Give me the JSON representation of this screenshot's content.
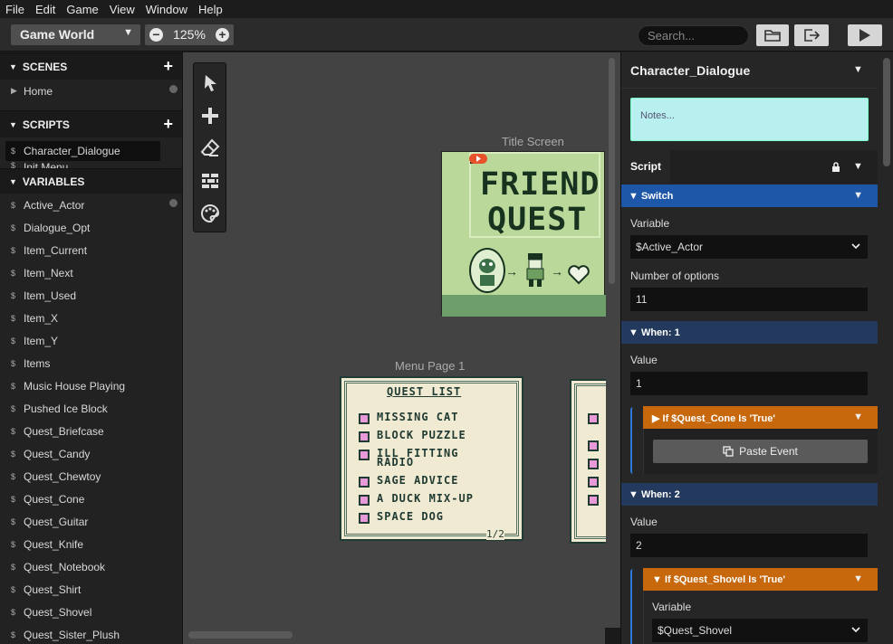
{
  "menu": [
    "File",
    "Edit",
    "Game",
    "View",
    "Window",
    "Help"
  ],
  "toolbar": {
    "world": "Game World",
    "zoom": "125%",
    "search_placeholder": "Search..."
  },
  "sidebar": {
    "scenes_header": "SCENES",
    "scenes": [
      "Home"
    ],
    "scripts_header": "SCRIPTS",
    "scripts": [
      "Character_Dialogue",
      "Init Menu"
    ],
    "variables_header": "VARIABLES",
    "variables": [
      "Active_Actor",
      "Dialogue_Opt",
      "Item_Current",
      "Item_Next",
      "Item_Used",
      "Item_X",
      "Item_Y",
      "Items",
      "Music House Playing",
      "Pushed Ice Block",
      "Quest_Briefcase",
      "Quest_Candy",
      "Quest_Chewtoy",
      "Quest_Cone",
      "Quest_Guitar",
      "Quest_Knife",
      "Quest_Notebook",
      "Quest_Shirt",
      "Quest_Shovel",
      "Quest_Sister_Plush"
    ]
  },
  "canvas": {
    "title_scene_label": "Title Screen",
    "title_text_1": "FRIEND",
    "title_text_2": "QUEST",
    "menu_scene_label": "Menu Page 1",
    "quest_list_title": "QUEST LIST",
    "quest_items": [
      "MISSING CAT",
      "BLOCK PUZZLE",
      "ILL FITTING RADIO",
      "SAGE ADVICE",
      "A DUCK MIX-UP",
      "SPACE DOG"
    ],
    "page_indicator": "1/2"
  },
  "panel": {
    "title": "Character_Dialogue",
    "notes_placeholder": "Notes...",
    "tab_script": "Script",
    "switch_label": "Switch",
    "variable_label": "Variable",
    "variable_value": "$Active_Actor",
    "options_label": "Number of options",
    "options_value": "11",
    "when1": "When: 1",
    "value_label": "Value",
    "value1": "1",
    "if1": "If $Quest_Cone Is 'True'",
    "paste": "Paste Event",
    "when2": "When: 2",
    "value2": "2",
    "if2": "If $Quest_Shovel Is 'True'",
    "variable2_value": "$Quest_Shovel"
  },
  "colors": {
    "accent_blue": "#1e57a8",
    "if_orange": "#c8680c",
    "gb_green": "#b9d89a",
    "notes_bg": "#b8f0f0"
  }
}
